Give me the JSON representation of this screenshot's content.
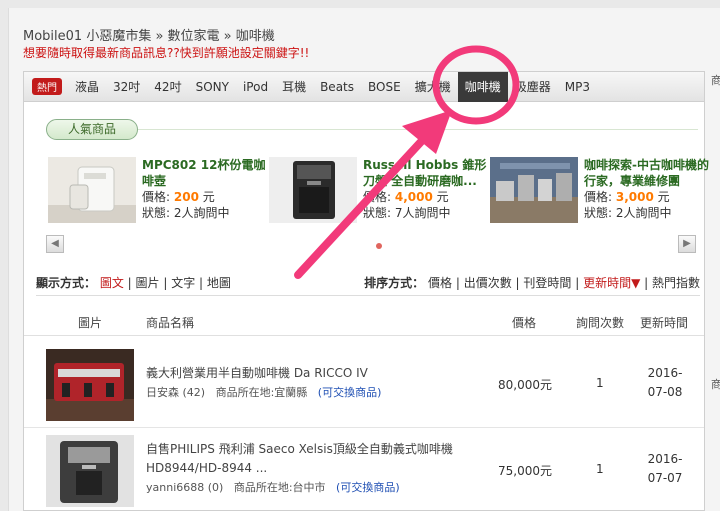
{
  "breadcrumb": "Mobile01 小惡魔市集 » 數位家電 » 咖啡機",
  "promo": "想要隨時取得最新商品訊息??快到許願池設定關鍵字!!",
  "tabs": {
    "hot_badge": "熱門",
    "items": [
      {
        "label": "液晶"
      },
      {
        "label": "32吋"
      },
      {
        "label": "42吋"
      },
      {
        "label": "SONY"
      },
      {
        "label": "iPod"
      },
      {
        "label": "耳機"
      },
      {
        "label": "Beats"
      },
      {
        "label": "BOSE"
      },
      {
        "label": "擴大機"
      },
      {
        "label": "咖啡機"
      },
      {
        "label": "吸塵器"
      },
      {
        "label": "MP3"
      }
    ],
    "active_index": 9
  },
  "popular": {
    "label": "人氣商品",
    "items": [
      {
        "title": "MPC802 12杯份電咖啡壺",
        "price_label": "價格:",
        "price": "200",
        "unit": "元",
        "status_label": "狀態:",
        "status": "2人詢問中"
      },
      {
        "title": "Russell Hobbs 錐形刀盤 全自動研磨咖...",
        "price_label": "價格:",
        "price": "4,000",
        "unit": "元",
        "status_label": "狀態:",
        "status": "7人詢問中"
      },
      {
        "title": "咖啡探索-中古咖啡機的行家，專業維修團",
        "price_label": "價格:",
        "price": "3,000",
        "unit": "元",
        "status_label": "狀態:",
        "status": "2人詢問中"
      }
    ]
  },
  "view": {
    "label": "顯示方式：",
    "options": [
      "圖文",
      "圖片",
      "文字",
      "地圖"
    ],
    "active": "圖文"
  },
  "sort": {
    "label": "排序方式：",
    "options": [
      "價格",
      "出價次數",
      "刊登時間",
      "更新時間▼",
      "熱門指數"
    ],
    "active": "更新時間▼"
  },
  "table": {
    "headers": {
      "image": "圖片",
      "name": "商品名稱",
      "price": "價格",
      "inquiries": "詢問次數",
      "updated": "更新時間"
    },
    "rows": [
      {
        "title": "義大利營業用半自動咖啡機 Da RICCO IV",
        "seller": "日安森 (42)",
        "location": "商品所在地:宜蘭縣",
        "trade": "(可交換商品)",
        "price": "80,000元",
        "count": "1",
        "date": "2016-07-08"
      },
      {
        "title": "自售PHILIPS 飛利浦 Saeco Xelsis頂級全自動義式咖啡機 HD8944/HD-8944 ...",
        "seller": "yanni6688 (0)",
        "location": "商品所在地:台中市",
        "trade": "(可交換商品)",
        "price": "75,000元",
        "count": "1",
        "date": "2016-07-07"
      }
    ]
  },
  "side": {
    "top_char": "商",
    "mid_char": "商"
  },
  "colors": {
    "annotation": "#f23a7a",
    "price": "#ff7a00",
    "title_green": "#2b6a22",
    "hot_red": "#c21b1b"
  }
}
